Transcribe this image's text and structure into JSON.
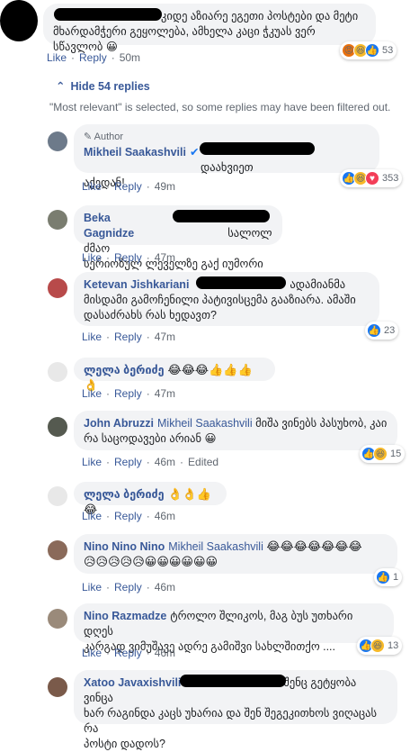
{
  "top_comment": {
    "text": "კიდე აზიარე ეგეთი პოსტები და მეტი მხარდამჭერი გეყოლება, ამხელა კაცი ჭკუას ვერ სწავლობ 😀",
    "line1": "კიდე აზიარე ეგეთი პოსტები და მეტი",
    "line2": "მხარდამჭერი გეყოლება, ამხელა კაცი ჭკუას ვერ სწავლობ 😀",
    "like": "Like",
    "reply": "Reply",
    "time": "50m",
    "reaction_count": "53"
  },
  "hide_replies": "Hide 54 replies",
  "filter_notice": "\"Most relevant\" is selected, so some replies may have been filtered out.",
  "replies": [
    {
      "author_badge": "Author",
      "name": "Mikheil Saakashvili",
      "verified": "✔",
      "line1": "დაახვიეთ",
      "line2": "აქედან!",
      "time": "49m",
      "reaction_count": "353"
    },
    {
      "name": "Beka Gagnidze",
      "line1": "სალოლ ძმაო",
      "line2": "სერიოზულ ლეველზე გაქ იუმორი❤️",
      "time": "47m"
    },
    {
      "name": "Ketevan Jishkariani",
      "line1": "ადამიანმა",
      "line2": "მისდამი გამოჩენილი პატივისცემა გააზიარა. ამაში",
      "line3": "დასაძრახს რას ხედავთ?",
      "time": "47m",
      "reaction_count": "23"
    },
    {
      "name": "ლელა ბერიძე",
      "emojis": "😂😂😂👍👍👍👌",
      "time": "47m"
    },
    {
      "name": "John Abruzzi",
      "mention": "Mikheil Saakashvili",
      "line1": "მიშა ვინებს პასუხობ, კაი",
      "line2": "რა საცოდავები არიან 😀",
      "time": "46m",
      "edited": "Edited",
      "reaction_count": "15"
    },
    {
      "name": "ლელა ბერიძე",
      "emojis": "👌👌👍😂",
      "time": "46m"
    },
    {
      "name": "Nino Nino Nino",
      "mention": "Mikheil Saakashvili",
      "emojis_line1": "😂😂😂😂😂😂😂",
      "emojis_line2": "😥😥😥😥😥😀😀😀😀😀😀",
      "time": "46m",
      "reaction_count": "1"
    },
    {
      "name": "Nino Razmadze",
      "line1": "ტროლო შლიკოს, მაგ ბუს უთხარი დღეს",
      "line2": "კარგად ვიმუშავე ადრე გამიშვი სახლშითქო ....",
      "time": "46m",
      "reaction_count": "13"
    },
    {
      "name": "Xatoo Javaxishvili",
      "line1": "შენც გეტყობა ვინცა",
      "line2": "ხარ რაგინდა კაცს უხარია და შენ შეგეკითხოს ვიღაცას რა",
      "line3": "პოსტი დადოს?"
    }
  ],
  "labels": {
    "like": "Like",
    "reply": "Reply",
    "sep": "·"
  },
  "colors": {
    "link": "#385898",
    "bubble": "#f2f3f5",
    "meta": "#606770",
    "like": "#1877f2"
  }
}
